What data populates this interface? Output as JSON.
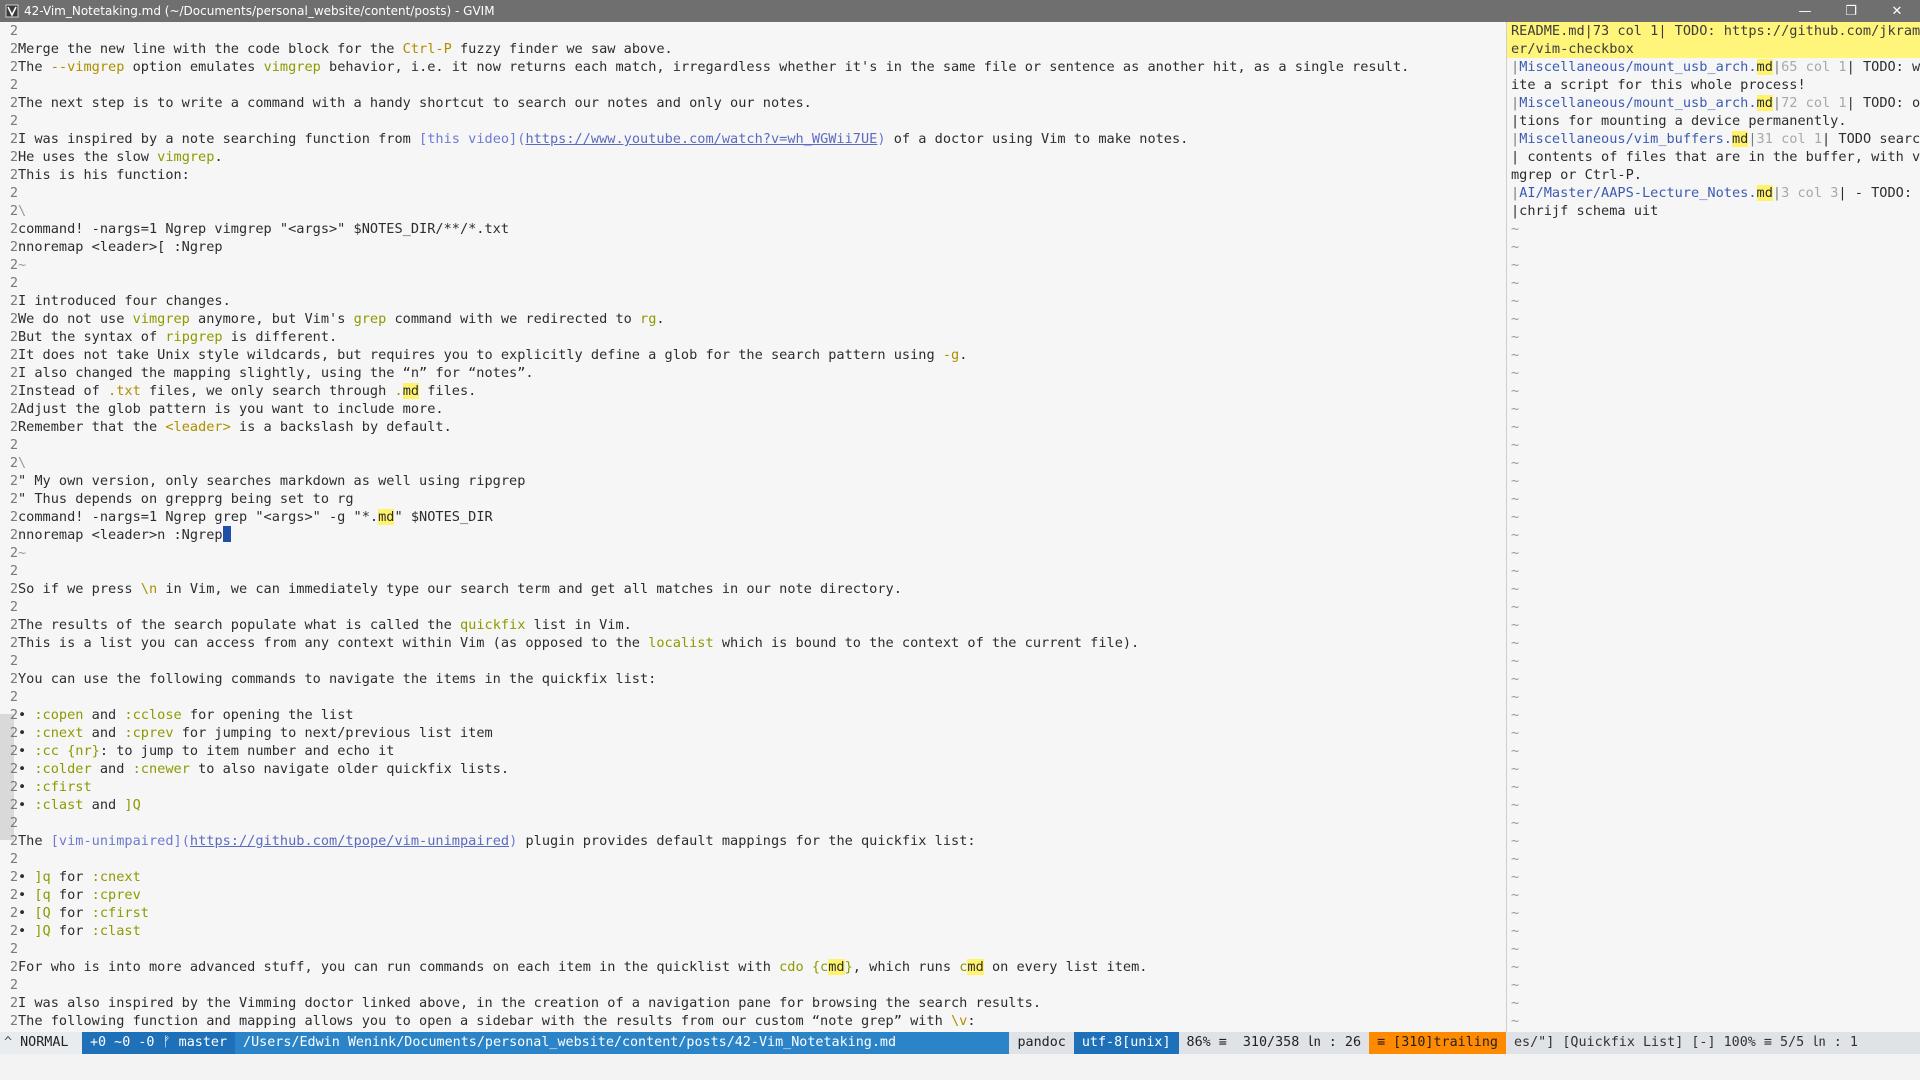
{
  "window": {
    "title": "42-Vim_Notetaking.md (~/Documents/personal_website/content/posts) - GVIM",
    "icons": [
      "vim-icon",
      "minimize-icon",
      "maximize-icon",
      "close-icon"
    ]
  },
  "editor": {
    "gutter_char": "2",
    "lines": [
      [],
      [
        {
          "t": "Merge the new line with the code block for the "
        },
        {
          "t": "Ctrl-P",
          "c": "key"
        },
        {
          "t": " fuzzy finder we saw above."
        }
      ],
      [
        {
          "t": "The "
        },
        {
          "t": "--vimgrep",
          "c": "key"
        },
        {
          "t": " option emulates "
        },
        {
          "t": "vimgrep",
          "c": "cmd"
        },
        {
          "t": " behavior, i.e. it now returns each match, irregardless whether it's in the same file or sentence as another hit, as a single result."
        }
      ],
      [],
      [
        {
          "t": "The next step is to write a command with a handy shortcut to search our notes and only our notes."
        }
      ],
      [],
      [
        {
          "t": "I was inspired by a note searching function from "
        },
        {
          "t": "[this video]",
          "c": "linktxt"
        },
        {
          "t": "(",
          "c": "linktxt"
        },
        {
          "t": "https://www.youtube.com/watch?v=wh_WGWii7UE",
          "c": "link"
        },
        {
          "t": ")",
          "c": "linktxt"
        },
        {
          "t": " of a doctor using Vim to make notes."
        }
      ],
      [
        {
          "t": "He uses the slow "
        },
        {
          "t": "vimgrep",
          "c": "cmd"
        },
        {
          "t": "."
        }
      ],
      [
        {
          "t": "This is his function:"
        }
      ],
      [],
      [
        {
          "t": "\\",
          "c": "tilde"
        }
      ],
      [
        {
          "t": "command! -nargs=1 Ngrep vimgrep \"<args>\" $NOTES_DIR/**/*.txt"
        }
      ],
      [
        {
          "t": "nnoremap <leader>[ :Ngrep"
        }
      ],
      [
        {
          "t": "~",
          "c": "tilde"
        }
      ],
      [],
      [
        {
          "t": "I introduced four changes."
        }
      ],
      [
        {
          "t": "We do not use "
        },
        {
          "t": "vimgrep",
          "c": "cmd"
        },
        {
          "t": " anymore, but Vim's "
        },
        {
          "t": "grep",
          "c": "cmd"
        },
        {
          "t": " command with we redirected to "
        },
        {
          "t": "rg",
          "c": "cmd"
        },
        {
          "t": "."
        }
      ],
      [
        {
          "t": "But the syntax of "
        },
        {
          "t": "ripgrep",
          "c": "cmd"
        },
        {
          "t": " is different."
        }
      ],
      [
        {
          "t": "It does not take Unix style wildcards, but requires you to explicitly define a glob for the search pattern using "
        },
        {
          "t": "-g",
          "c": "key"
        },
        {
          "t": "."
        }
      ],
      [
        {
          "t": "I also changed the mapping slightly, using the “n” for “notes”."
        }
      ],
      [
        {
          "t": "Instead of "
        },
        {
          "t": ".txt",
          "c": "key"
        },
        {
          "t": " files, we only search through "
        },
        {
          "t": ".",
          "c": "key"
        },
        {
          "t": "md",
          "c": "mdhl"
        },
        {
          "t": " files."
        }
      ],
      [
        {
          "t": "Adjust the glob pattern is you want to include more."
        }
      ],
      [
        {
          "t": "Remember that the "
        },
        {
          "t": "<leader>",
          "c": "key"
        },
        {
          "t": " is a backslash by default."
        }
      ],
      [],
      [
        {
          "t": "\\",
          "c": "tilde"
        }
      ],
      [
        {
          "t": "\" My own version, only searches markdown as well using ripgrep"
        }
      ],
      [
        {
          "t": "\" Thus depends on grepprg being set to rg"
        }
      ],
      [
        {
          "t": "command! -nargs=1 Ngrep grep \"<args>\" -g \"*."
        },
        {
          "t": "md",
          "c": "mdhl"
        },
        {
          "t": "\" $NOTES_DIR"
        }
      ],
      [
        {
          "t": "nnoremap <leader>n :Ngrep"
        },
        {
          "t": "",
          "c": "cursor"
        }
      ],
      [
        {
          "t": "~",
          "c": "tilde"
        }
      ],
      [],
      [
        {
          "t": "So if we press "
        },
        {
          "t": "\\n",
          "c": "key"
        },
        {
          "t": " in Vim, we can immediately type our search term and get all matches in our note directory."
        }
      ],
      [],
      [
        {
          "t": "The results of the search populate what is called the "
        },
        {
          "t": "quickfix",
          "c": "cmd"
        },
        {
          "t": " list in Vim."
        }
      ],
      [
        {
          "t": "This is a list you can access from any context within Vim (as opposed to the "
        },
        {
          "t": "localist",
          "c": "cmd"
        },
        {
          "t": " which is bound to the context of the current file)."
        }
      ],
      [],
      [
        {
          "t": "You can use the following commands to navigate the items in the quickfix list:"
        }
      ],
      [],
      [
        {
          "t": "• "
        },
        {
          "t": ":copen",
          "c": "cmd"
        },
        {
          "t": " and "
        },
        {
          "t": ":cclose",
          "c": "cmd"
        },
        {
          "t": " for opening the list"
        }
      ],
      [
        {
          "t": "• "
        },
        {
          "t": ":cnext",
          "c": "cmd"
        },
        {
          "t": " and "
        },
        {
          "t": ":cprev",
          "c": "cmd"
        },
        {
          "t": " for jumping to next/previous list item"
        }
      ],
      [
        {
          "t": "• "
        },
        {
          "t": ":cc {nr}",
          "c": "cmd"
        },
        {
          "t": ": to jump to item number and echo it"
        }
      ],
      [
        {
          "t": "• "
        },
        {
          "t": ":colder",
          "c": "cmd"
        },
        {
          "t": " and "
        },
        {
          "t": ":cnewer",
          "c": "cmd"
        },
        {
          "t": " to also navigate older quickfix lists."
        }
      ],
      [
        {
          "t": "• "
        },
        {
          "t": ":cfirst",
          "c": "cmd"
        }
      ],
      [
        {
          "t": "• "
        },
        {
          "t": ":clast",
          "c": "cmd"
        },
        {
          "t": " and "
        },
        {
          "t": "]Q",
          "c": "cmd"
        }
      ],
      [],
      [
        {
          "t": "The "
        },
        {
          "t": "[vim-unimpaired]",
          "c": "linktxt"
        },
        {
          "t": "(",
          "c": "linktxt"
        },
        {
          "t": "https://github.com/tpope/vim-unimpaired",
          "c": "link"
        },
        {
          "t": ")",
          "c": "linktxt"
        },
        {
          "t": " plugin provides default mappings for the quickfix list:"
        }
      ],
      [],
      [
        {
          "t": "• "
        },
        {
          "t": "]q",
          "c": "cmd"
        },
        {
          "t": " for "
        },
        {
          "t": ":cnext",
          "c": "cmd"
        }
      ],
      [
        {
          "t": "• "
        },
        {
          "t": "[q",
          "c": "cmd"
        },
        {
          "t": " for "
        },
        {
          "t": ":cprev",
          "c": "cmd"
        }
      ],
      [
        {
          "t": "• "
        },
        {
          "t": "[Q",
          "c": "cmd"
        },
        {
          "t": " for "
        },
        {
          "t": ":cfirst",
          "c": "cmd"
        }
      ],
      [
        {
          "t": "• "
        },
        {
          "t": "]Q",
          "c": "cmd"
        },
        {
          "t": " for "
        },
        {
          "t": ":clast",
          "c": "cmd"
        }
      ],
      [],
      [
        {
          "t": "For who is into more advanced stuff, you can run commands on each item in the quicklist with "
        },
        {
          "t": "cdo {c",
          "c": "cmd"
        },
        {
          "t": "md",
          "c": "mdhl"
        },
        {
          "t": "}",
          "c": "cmd"
        },
        {
          "t": ", which runs "
        },
        {
          "t": "c",
          "c": "cmd"
        },
        {
          "t": "md",
          "c": "mdhl"
        },
        {
          "t": " on every list item."
        }
      ],
      [],
      [
        {
          "t": "I was also inspired by the Vimming doctor linked above, in the creation of a navigation pane for browsing the search results."
        }
      ],
      [
        {
          "t": "The following function and mapping allows you to open a sidebar with the results from our custom “note grep” with "
        },
        {
          "t": "\\v",
          "c": "key"
        },
        {
          "t": ":"
        }
      ]
    ]
  },
  "quickfix": {
    "lines": [
      {
        "top": true,
        "parts": [
          {
            "t": "README.md|73 col 1| TODO: https://github.com/jkram"
          }
        ]
      },
      {
        "top": true,
        "parts": [
          {
            "t": "er/vim-checkbox"
          }
        ]
      },
      {
        "parts": [
          {
            "t": "|",
            "c": "sep"
          },
          {
            "t": "Miscellaneous/mount_usb_arch.",
            "c": "file"
          },
          {
            "t": "md",
            "c": "mdhl"
          },
          {
            "t": "|",
            "c": "sep"
          },
          {
            "t": "65 col 1",
            "c": "pos"
          },
          {
            "t": "| TODO: wr"
          }
        ]
      },
      {
        "parts": [
          {
            "t": "ite a script for this whole process!"
          }
        ]
      },
      {
        "parts": [
          {
            "t": "|",
            "c": "sep"
          },
          {
            "t": "Miscellaneous/mount_usb_arch.",
            "c": "file"
          },
          {
            "t": "md",
            "c": "mdhl"
          },
          {
            "t": "|",
            "c": "sep"
          },
          {
            "t": "72 col 1",
            "c": "pos"
          },
          {
            "t": "| TODO: op"
          }
        ]
      },
      {
        "parts": [
          {
            "t": "|tions for mounting a device permanently."
          }
        ]
      },
      {
        "parts": [
          {
            "t": "|",
            "c": "sep"
          },
          {
            "t": "Miscellaneous/vim_buffers.",
            "c": "file"
          },
          {
            "t": "md",
            "c": "mdhl"
          },
          {
            "t": "|",
            "c": "sep"
          },
          {
            "t": "31 col 1",
            "c": "pos"
          },
          {
            "t": "| TODO search"
          }
        ]
      },
      {
        "parts": [
          {
            "t": "| contents of files that are in the buffer, with vi"
          }
        ]
      },
      {
        "parts": [
          {
            "t": "mgrep or Ctrl-P."
          }
        ]
      },
      {
        "parts": [
          {
            "t": "|",
            "c": "sep"
          },
          {
            "t": "AI/Master/AAPS-Lecture_Notes.",
            "c": "file"
          },
          {
            "t": "md",
            "c": "mdhl"
          },
          {
            "t": "|",
            "c": "sep"
          },
          {
            "t": "3 col 3",
            "c": "pos"
          },
          {
            "t": "| - TODO: S"
          }
        ]
      },
      {
        "parts": [
          {
            "t": "|chrijf schema uit"
          }
        ]
      }
    ],
    "tilde": "~"
  },
  "statusbar": {
    "mode": "NORMAL",
    "mode_arrow": "^",
    "git": "+0 ~0 -0 ᚠ master",
    "path": "/Users/Edwin Wenink/Documents/personal_website/content/posts/42-Vim_Notetaking.md",
    "filetype": "pandoc",
    "encoding": "utf-8[unix]",
    "percent": "86% ≡",
    "position": "310/358  ㏑ : 26",
    "warning": "≡ [310]trailing",
    "quickfix_info": "es/\"] [Quickfix List] [-]   100% ≡    5/5 ㏑ :  1"
  }
}
